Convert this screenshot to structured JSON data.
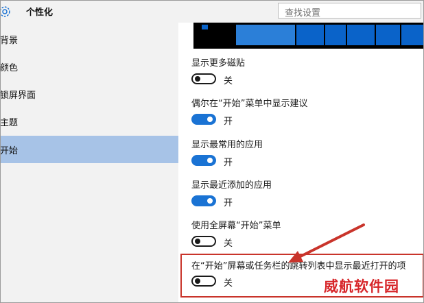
{
  "header": {
    "title": "个性化",
    "search_placeholder": "查找设置"
  },
  "sidebar": {
    "items": [
      {
        "label": "背景",
        "active": false
      },
      {
        "label": "颜色",
        "active": false
      },
      {
        "label": "锁屏界面",
        "active": false
      },
      {
        "label": "主题",
        "active": false
      },
      {
        "label": "开始",
        "active": true
      }
    ]
  },
  "settings": [
    {
      "label": "显示更多磁贴",
      "state": "关",
      "on": false
    },
    {
      "label": "偶尔在“开始”菜单中显示建议",
      "state": "开",
      "on": true
    },
    {
      "label": "显示最常用的应用",
      "state": "开",
      "on": true
    },
    {
      "label": "显示最近添加的应用",
      "state": "开",
      "on": true
    },
    {
      "label": "使用全屏幕“开始”菜单",
      "state": "关",
      "on": false
    },
    {
      "label": "在“开始”屏幕或任务栏的跳转列表中显示最近打开的项",
      "state": "关",
      "on": false
    }
  ],
  "colors": {
    "accent": "#1a73d4",
    "active_nav": "#a7c3e7",
    "annotation": "#c9342b"
  },
  "watermark": "威航软件园"
}
